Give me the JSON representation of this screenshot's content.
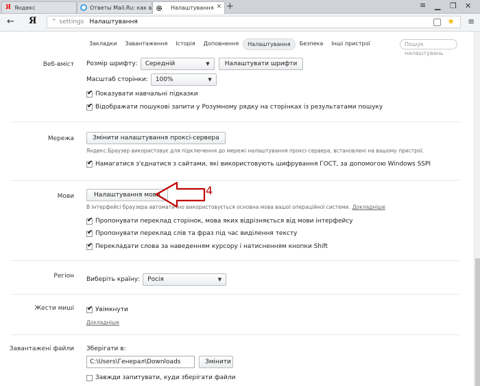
{
  "browser": {
    "tabs": [
      {
        "label": "Яндекс",
        "icon": "yandex-favicon"
      },
      {
        "label": "Ответы Mail.Ru: как в \"Янде",
        "icon": "mailru-favicon"
      },
      {
        "label": "Налаштування",
        "icon": "gear-icon",
        "active": true
      }
    ],
    "newtab_glyph": "+",
    "address": {
      "logo": "Я",
      "prefix": "settings",
      "title": "Налаштування"
    }
  },
  "settings_nav": {
    "items": [
      "Закладки",
      "Завантаження",
      "Історія",
      "Доповнення",
      "Налаштування",
      "Безпека",
      "Інші пристрої"
    ],
    "active_index": 4,
    "search_placeholder": "Пошук налаштувань"
  },
  "web_content": {
    "label": "Веб-вміст",
    "font_size_label": "Розмір шрифту:",
    "font_size_value": "Середній",
    "customize_fonts_button": "Налаштувати шрифти",
    "zoom_label": "Масштаб сторінки:",
    "zoom_value": "100%",
    "show_tutorial_tips": "Показувати навчальні підказки",
    "show_search_queries": "Відображати пошукові запити у Розумному рядку на сторінках із результатами пошуку"
  },
  "network": {
    "label": "Мережа",
    "proxy_button": "Змінити налаштування проксі-сервера",
    "proxy_note": "Яндекс.Браузер використовує для підключення до мережі налаштування проксі-сервера, встановлені на вашому пристрої.",
    "gost_checkbox": "Намагатися з'єднатися з сайтами, які використовують шифрування ГОСТ, за допомогою Windows SSPI"
  },
  "languages": {
    "label": "Мови",
    "settings_button": "Налаштування мови",
    "note": "В інтерфейсі браузера автоматично використовується основна мова вашої операційної системи.",
    "note_link": "Докладніше",
    "offer_translate_pages": "Пропонувати переклад сторінок, мова яких відрізняється від мови інтерфейсу",
    "offer_translate_words": "Пропонувати переклад слів та фраз під час виділення тексту",
    "translate_on_hover": "Перекладати слова за наведенням курсору і натисненням кнопки Shift"
  },
  "region": {
    "label": "Регіон",
    "select_label": "Виберіть країну:",
    "select_value": "Росія"
  },
  "mouse_gestures": {
    "label": "Жести миші",
    "enable": "Увімкнути",
    "more_link": "Докладніше"
  },
  "downloads": {
    "label": "Завантажені файли",
    "save_to_label": "Зберігати в:",
    "path_value": "C:\\Users\\Генерал\\Downloads",
    "change_button": "Змінити",
    "always_ask": "Завжди запитувати, куди зберігати файли"
  },
  "annotation": {
    "number": "4",
    "color": "#c00000"
  },
  "colors": {
    "tabstrip": "#cfd3d8",
    "star": "#f2b705"
  }
}
